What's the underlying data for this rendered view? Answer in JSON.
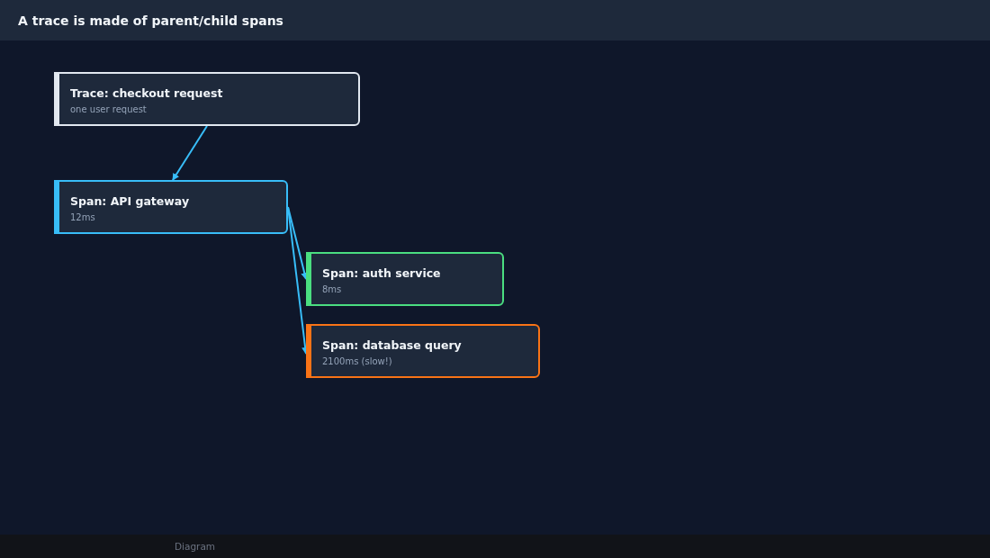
{
  "window": {
    "title": "A trace is made of parent/child spans"
  },
  "trace": {
    "title": "Trace: checkout request",
    "detail": "one user request",
    "color": "#e2e8f0",
    "children": [
      {
        "title": "Span: API gateway",
        "detail": "12ms",
        "color": "#38bdf8",
        "children": [
          {
            "title": "Span: auth service",
            "detail": "8ms",
            "color": "#4ade80"
          },
          {
            "title": "Span: database query",
            "detail": "2100ms (slow!)",
            "color": "#f97316"
          }
        ]
      }
    ]
  },
  "status_bar": {
    "text": "Diagram"
  }
}
